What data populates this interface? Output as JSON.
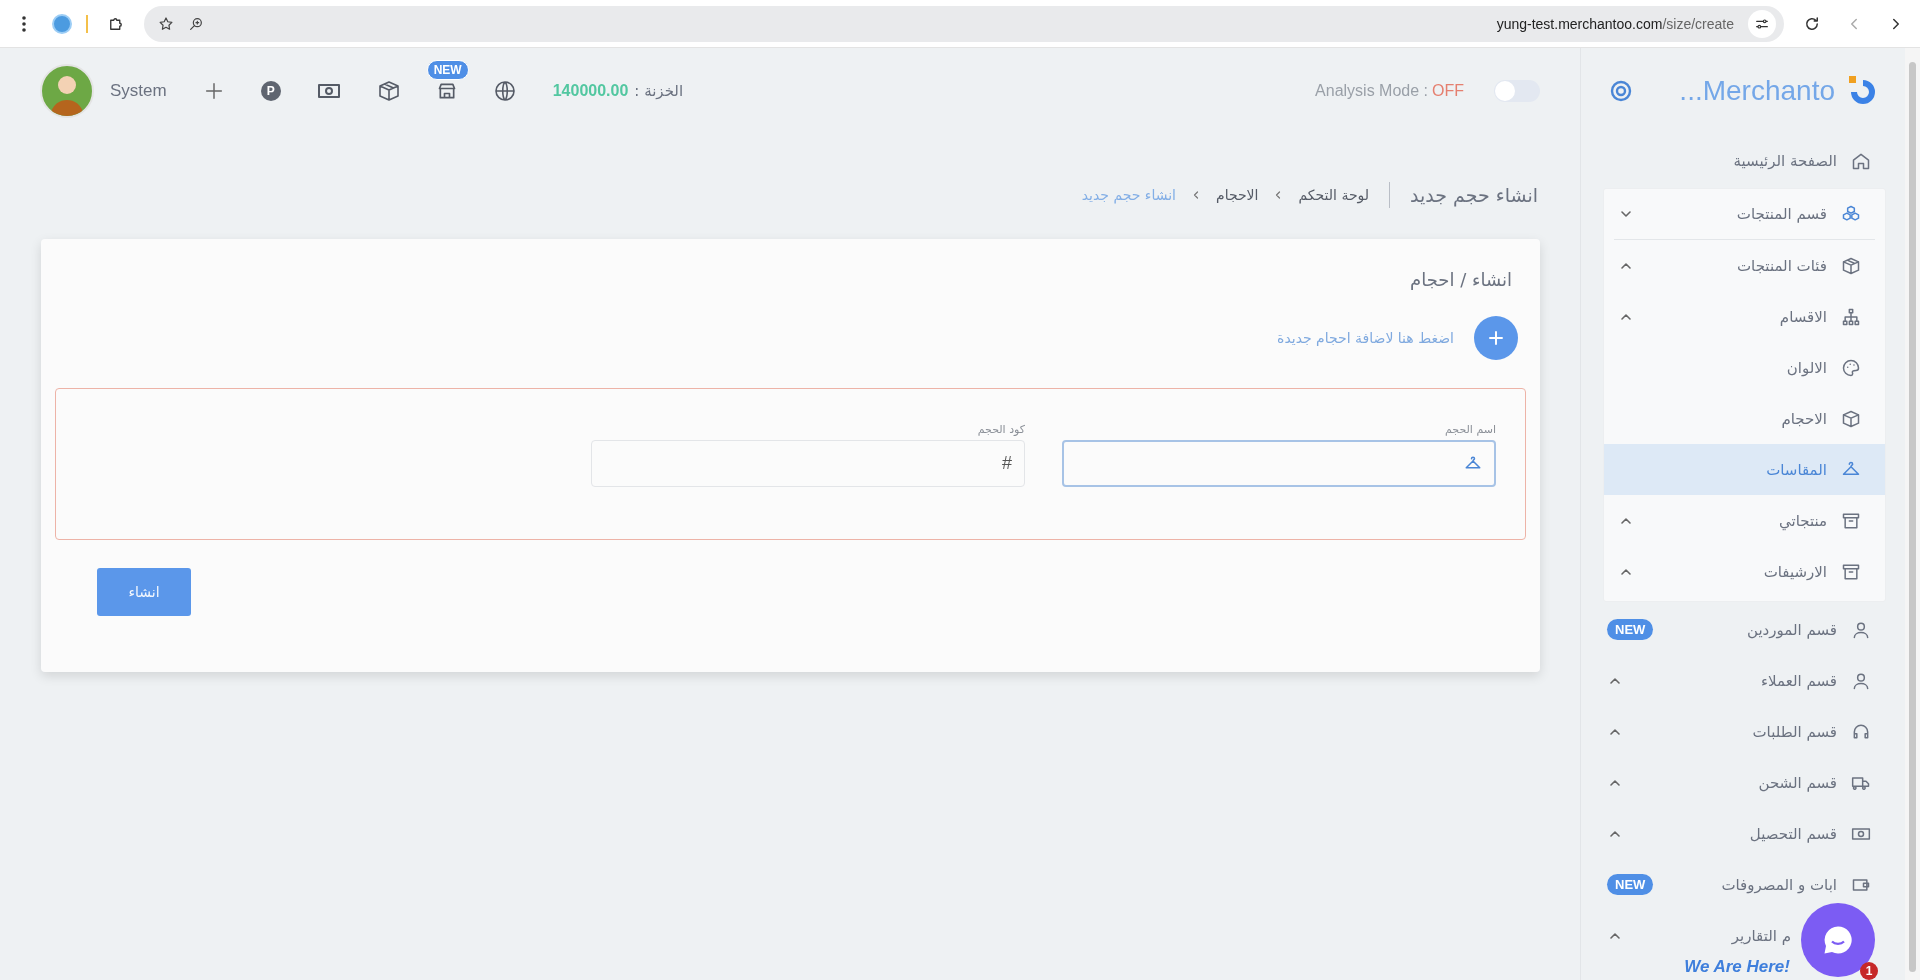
{
  "browser": {
    "url_host": "yung-test.merchantoo.com",
    "url_path": "/size/create"
  },
  "header": {
    "user": "System",
    "p_glyph": "P",
    "new_badge": "NEW",
    "treasury_label": "الخزنة :",
    "treasury_value": "140000.00",
    "analysis_label": "Analysis Mode :",
    "analysis_value": "OFF",
    "analysis_on": false
  },
  "sidebar": {
    "brand": "...Merchanto",
    "items": [
      {
        "label": "الصفحة الرئيسية",
        "kind": "home",
        "selected": false
      },
      {
        "label": "قسم المنتجات",
        "kind": "cubes",
        "selected": false,
        "expanded": true,
        "children": [
          {
            "label": "فئات المنتجات",
            "kind": "box",
            "selected": false,
            "expanded": false
          },
          {
            "label": "الاقسام",
            "kind": "sitemap",
            "selected": false,
            "expanded": false
          },
          {
            "label": "الالوان",
            "kind": "palette",
            "selected": false
          },
          {
            "label": "الاحجام",
            "kind": "cube",
            "selected": false
          },
          {
            "label": "المقاسات",
            "kind": "hanger",
            "selected": true
          },
          {
            "label": "منتجاتي",
            "kind": "archive",
            "selected": false,
            "expanded": false
          },
          {
            "label": "الارشيفات",
            "kind": "archive",
            "selected": false,
            "expanded": false
          }
        ]
      },
      {
        "label": "قسم الموردين",
        "kind": "user",
        "selected": false,
        "badge": "NEW"
      },
      {
        "label": "قسم العملاء",
        "kind": "user",
        "selected": false,
        "expanded": false
      },
      {
        "label": "قسم الطلبات",
        "kind": "headset",
        "selected": false,
        "expanded": false
      },
      {
        "label": "قسم الشحن",
        "kind": "truck",
        "selected": false,
        "expanded": false
      },
      {
        "label": "قسم التحصيل",
        "kind": "money",
        "selected": false,
        "expanded": false
      },
      {
        "label": "ابات و المصروفات",
        "kind": "wallet",
        "selected": false,
        "badge": "NEW"
      },
      {
        "label": "م التقارير",
        "selected": false,
        "expanded": false
      }
    ]
  },
  "page_title": "انشاء حجم جديد",
  "breadcrumbs": [
    {
      "label": "لوحة التحكم",
      "current": false
    },
    {
      "label": "الاحجام",
      "current": false
    },
    {
      "label": "انشاء حجم جديد",
      "current": true
    }
  ],
  "card": {
    "title": "انشاء / احجام",
    "add_link": "اضغط هنا لاضافة احجام جديدة",
    "fields": [
      {
        "label": "اسم الحجم",
        "focused": true
      },
      {
        "label": "كود الحجم",
        "prefix": "#",
        "focused": false
      }
    ],
    "submit": "انشاء"
  },
  "chat": {
    "tagline": "We Are Here!",
    "badge": "1"
  }
}
